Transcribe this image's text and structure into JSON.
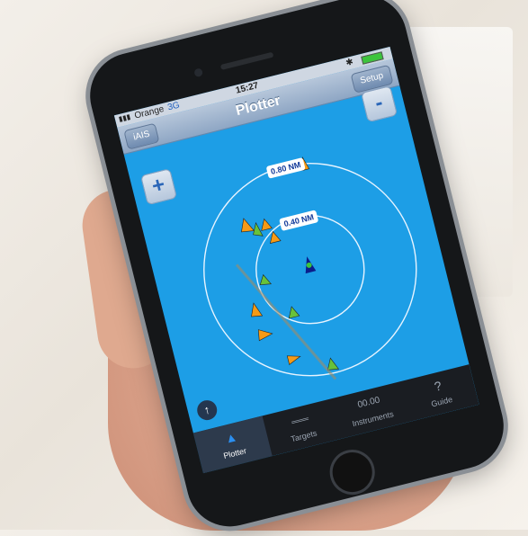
{
  "status": {
    "carrier": "Orange",
    "network": "3G",
    "time": "15:27"
  },
  "navbar": {
    "title": "Plotter",
    "back_label": "iAIS",
    "setup_label": "Setup"
  },
  "map": {
    "zoom_in": "+",
    "zoom_out": "-",
    "range_outer": "0.80 NM",
    "range_inner": "0.40 NM",
    "north_icon": "↑"
  },
  "tabs": [
    {
      "label": "Plotter",
      "icon": "▲"
    },
    {
      "label": "Targets",
      "icon": "═══"
    },
    {
      "label": "Instruments",
      "icon": "00.00"
    },
    {
      "label": "Guide",
      "icon": "?"
    }
  ],
  "colors": {
    "sea": "#1d9ee6",
    "own_ship": "#0b1d8a",
    "target_fill": "#f59a16",
    "target_alt": "#67c23a"
  }
}
